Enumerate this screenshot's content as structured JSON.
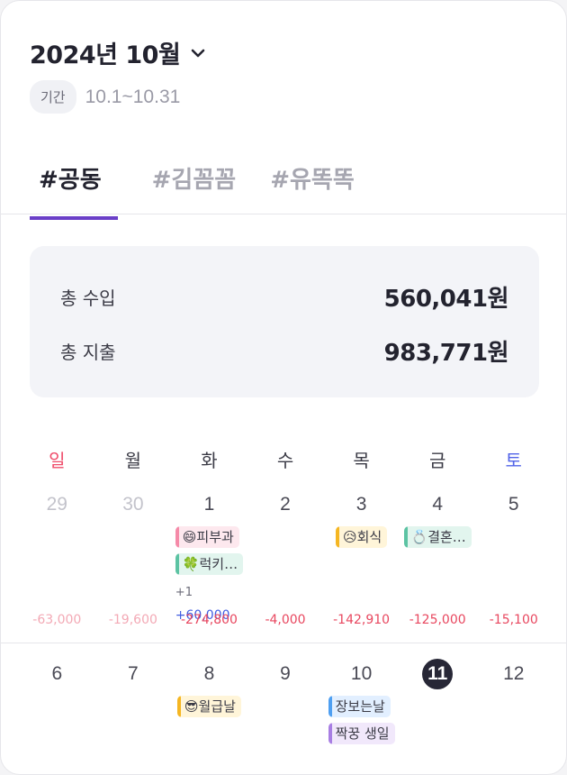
{
  "header": {
    "title": "2024년 10월",
    "chevron_icon": "chevron-down-icon"
  },
  "period": {
    "badge": "기간",
    "range": "10.1~10.31"
  },
  "tabs": [
    {
      "label": "#공동",
      "active": true
    },
    {
      "label": "#김꼼꼼",
      "active": false
    },
    {
      "label": "#유똑똑",
      "active": false
    }
  ],
  "summary": {
    "income_label": "총 수입",
    "income_value": "560,041원",
    "expense_label": "총 지출",
    "expense_value": "983,771원"
  },
  "weekdays": [
    "일",
    "월",
    "화",
    "수",
    "목",
    "금",
    "토"
  ],
  "colors": {
    "accent": "#6a3fc8",
    "sunday": "#ef4d6b",
    "saturday": "#5264e8",
    "expense": "#e8475f",
    "income": "#3f5ce0",
    "today_bg": "#272736"
  },
  "week1": {
    "days": [
      "29",
      "30",
      "1",
      "2",
      "3",
      "4",
      "5"
    ],
    "amounts": [
      "-63,000",
      "-19,600",
      "-274,800",
      "-4,000",
      "-142,910",
      "-125,000",
      "-15,100"
    ],
    "tue_events": [
      "😄피부과",
      "🍀럭키…"
    ],
    "tue_more": "+1",
    "tue_income": "+60,000",
    "thu_events": [
      "😥회식"
    ],
    "fri_events": [
      "💍결혼…"
    ]
  },
  "week2": {
    "days": [
      "6",
      "7",
      "8",
      "9",
      "10",
      "11",
      "12"
    ],
    "tue_events": [
      "😎월급날"
    ],
    "thu_events": [
      "장보는날",
      "짝꿍 생일"
    ]
  }
}
